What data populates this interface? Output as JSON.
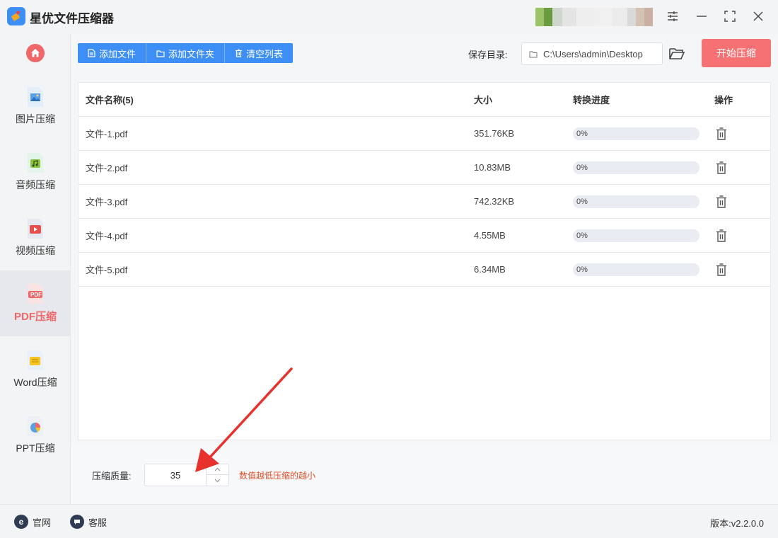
{
  "app": {
    "title": "星优文件压缩器"
  },
  "sidebar": {
    "items": [
      {
        "label": "图片压缩",
        "icon": "image-file-icon"
      },
      {
        "label": "音频压缩",
        "icon": "audio-file-icon"
      },
      {
        "label": "视频压缩",
        "icon": "video-file-icon"
      },
      {
        "label": "PDF压缩",
        "icon": "pdf-file-icon",
        "active": true
      },
      {
        "label": "Word压缩",
        "icon": "word-file-icon"
      },
      {
        "label": "PPT压缩",
        "icon": "ppt-file-icon"
      }
    ],
    "pdf_badge": "PDF"
  },
  "toolbar": {
    "add_file": "添加文件",
    "add_folder": "添加文件夹",
    "clear_list": "清空列表",
    "save_label": "保存目录:",
    "save_path": "C:\\Users\\admin\\Desktop",
    "start": "开始压缩"
  },
  "table": {
    "headers": {
      "name": "文件名称(5)",
      "size": "大小",
      "progress": "转换进度",
      "action": "操作"
    },
    "rows": [
      {
        "name": "文件-1.pdf",
        "size": "351.76KB",
        "progress": "0%",
        "progress_value": 0
      },
      {
        "name": "文件-2.pdf",
        "size": "10.83MB",
        "progress": "0%",
        "progress_value": 0
      },
      {
        "name": "文件-3.pdf",
        "size": "742.32KB",
        "progress": "0%",
        "progress_value": 0
      },
      {
        "name": "文件-4.pdf",
        "size": "4.55MB",
        "progress": "0%",
        "progress_value": 0
      },
      {
        "name": "文件-5.pdf",
        "size": "6.34MB",
        "progress": "0%",
        "progress_value": 0
      }
    ]
  },
  "settings": {
    "quality_label": "压缩质量:",
    "quality_value": "35",
    "hint": "数值越低压缩的越小"
  },
  "footer": {
    "website": "官网",
    "support": "客服",
    "version": "版本:v2.2.0.0"
  },
  "colors": {
    "accent": "#3d8ef5",
    "start_button": "#f57173",
    "active_label": "#f0676a",
    "hint": "#e0522b",
    "annotation_arrow": "#e8312c"
  }
}
